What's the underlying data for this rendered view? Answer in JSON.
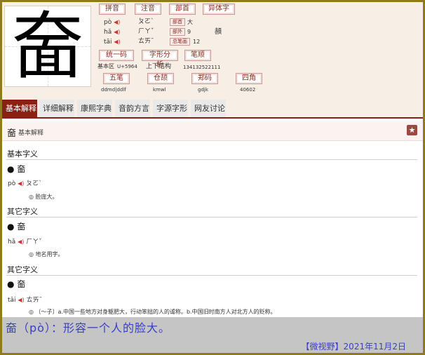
{
  "character": "奤",
  "header_buttons": {
    "pinyin": "拼音",
    "zhuyin": "注音",
    "bushou": "部首",
    "yitizi": "异体字",
    "tongyima": "统一码",
    "zixingfenxi": "字形分析",
    "bishun": "笔顺",
    "wubi": "五笔",
    "cangjie": "仓颉",
    "zhengma": "郑码",
    "sijiao": "四角"
  },
  "readings": [
    {
      "pinyin": "pò",
      "zhuyin": "ㄆㄛˋ"
    },
    {
      "pinyin": "hǎ",
      "zhuyin": "ㄏㄚˇ"
    },
    {
      "pinyin": "tāi",
      "zhuyin": "ㄊㄞˉ"
    }
  ],
  "speaker_glyph": "◀)",
  "radical": {
    "label": "部首",
    "value": "大"
  },
  "strokes_outside": {
    "label": "部外",
    "value": "9"
  },
  "total_strokes": {
    "label": "总笔画",
    "value": "12"
  },
  "variant_char": "頳",
  "unicode_area": "基本区",
  "unicode": "U+5964",
  "structure": "上下结构",
  "stroke_code": "134132522111",
  "wubi_code": "ddmd|ddlf",
  "cangjie_code": "kmwl",
  "zhengma_code": "gdjk",
  "sijiao_code": "40602",
  "tabs": [
    "基本解释",
    "详细解释",
    "康熙字典",
    "音韵方言",
    "字源字形",
    "网友讨论"
  ],
  "section": {
    "char": "奤",
    "title": "基本解释",
    "star_glyph": "★"
  },
  "definitions": [
    {
      "heading": "基本字义",
      "bullet": "● 奤",
      "pinyin": "pò",
      "zhuyin": "ㄆㄛˋ",
      "def": "◎ 脸庞大。"
    },
    {
      "heading": "其它字义",
      "bullet": "● 奤",
      "pinyin": "hǎ",
      "zhuyin": "ㄏㄚˇ",
      "def": "◎ 地名用字。"
    },
    {
      "heading": "其它字义",
      "bullet": "● 奤",
      "pinyin": "tāi",
      "zhuyin": "ㄊㄞˉ",
      "def": "◎ 〔～子〕a.中国一些地方对身躯肥大，行动笨拙的人的谑称。b.中国旧时南方人对北方人的贬称。"
    }
  ],
  "caption": "奤（pò）：形容一个人的脸大。",
  "footer": "【微视野】2021年11月2日"
}
